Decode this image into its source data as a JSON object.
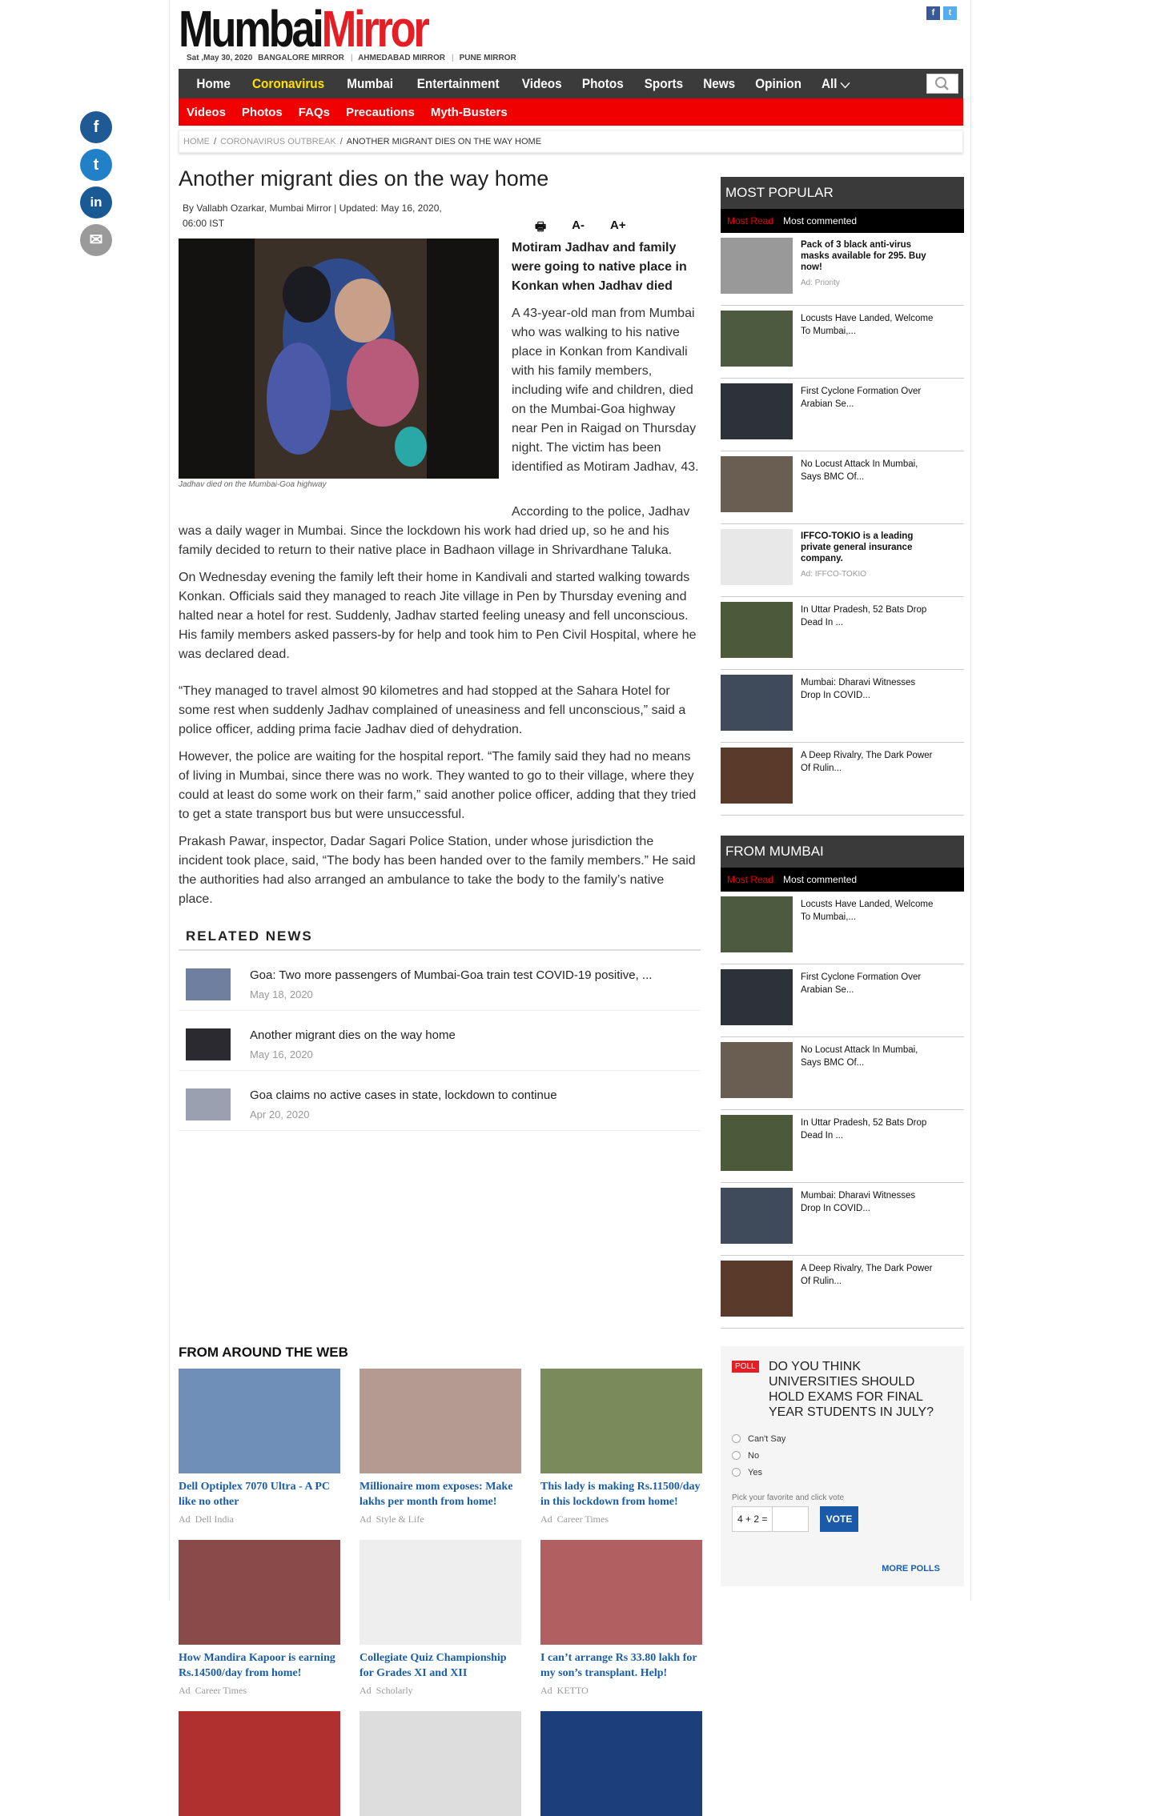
{
  "header": {
    "logo_part1": "Mumbai",
    "logo_part2": "Mirror",
    "date": "Sat ,May 30, 2020",
    "editions": [
      "BANGALORE MIRROR",
      "AHMEDABAD MIRROR",
      "PUNE MIRROR"
    ],
    "social_top": [
      "f",
      "t"
    ]
  },
  "nav_primary": [
    {
      "label": "Home",
      "active": false
    },
    {
      "label": "Coronavirus",
      "active": true
    },
    {
      "label": "Mumbai",
      "active": false
    },
    {
      "label": "Entertainment",
      "active": false
    },
    {
      "label": "Videos",
      "active": false
    },
    {
      "label": "Photos",
      "active": false
    },
    {
      "label": "Sports",
      "active": false
    },
    {
      "label": "News",
      "active": false
    },
    {
      "label": "Opinion",
      "active": false
    },
    {
      "label": "All",
      "active": false
    }
  ],
  "nav_secondary": [
    "Videos",
    "Photos",
    "FAQs",
    "Precautions",
    "Myth-Busters"
  ],
  "breadcrumb": [
    "HOME",
    "CORONAVIRUS OUTBREAK",
    "ANOTHER MIGRANT DIES ON THE WAY HOME"
  ],
  "share": {
    "facebook": "f",
    "twitter": "t",
    "linkedin": "in",
    "email": "✉"
  },
  "article": {
    "title": "Another migrant dies on the way home",
    "byline": "By Vallabh Ozarkar, Mumbai Mirror | Updated: May 16, 2020, 06:00 IST",
    "tools": {
      "print": "🖶",
      "font_down": "A-",
      "font_up": "A+"
    },
    "image_caption": "Jadhav died on the Mumbai-Goa highway",
    "lead": "Motiram Jadhav and family were going to native place in Konkan when Jadhav died",
    "p1": "A 43-year-old man from Mumbai who was walking to his native place in Konkan from Kandivali with his family members, including wife and children, died on the Mumbai-Goa highway near Pen in Raigad on Thursday night. The victim has been identified as Motiram Jadhav, 43.",
    "p2": "According to the police, Jadhav was a daily wager in Mumbai. Since the lockdown his work had dried up, so he and his family decided to return to their native place in Badhaon village in Shrivardhane Taluka.",
    "p3": "On Wednesday evening the family left their home in Kandivali and started walking towards Konkan. Officials said they managed to reach Jite village in Pen by Thursday evening and halted near a hotel for rest. Suddenly, Jadhav started feeling uneasy and fell unconscious. His family members asked passers-by for help and took him to Pen Civil Hospital, where he was declared dead.",
    "p4": "“They managed to travel almost 90 kilometres and had stopped at the Sahara Hotel for some rest when suddenly Jadhav complained of uneasiness and fell unconscious,” said a police officer, adding prima facie Jadhav died of dehydration.",
    "p5": "However, the police are waiting for the hospital report. “The family said they had no means of living in Mumbai, since there was no work. They wanted to go to their village, where they could at least do some work on their farm,” said another police officer, adding that they tried to get a state transport bus but were unsuccessful.",
    "p6": "Prakash Pawar, inspector, Dadar Sagari Police Station, under whose jurisdiction the incident took place, said, “The body has been handed over to the family members.” He said the authorities had also arranged an ambulance to take the body to the family’s native place."
  },
  "related": {
    "title": "RELATED NEWS",
    "items": [
      {
        "title": "Goa: Two more passengers of Mumbai-Goa train test COVID-19 positive, ...",
        "date": "May 18, 2020"
      },
      {
        "title": "Another migrant dies on the way home",
        "date": "May 16, 2020"
      },
      {
        "title": "Goa claims no active cases in state, lockdown to continue",
        "date": "Apr 20, 2020"
      }
    ]
  },
  "around_web": {
    "title": "FROM AROUND THE WEB",
    "cards": [
      {
        "title": "Dell Optiplex 7070 Ultra - A PC like no other",
        "ad": "Ad",
        "source": "Dell India",
        "color": "#6f8fb8"
      },
      {
        "title": "Millionaire mom exposes: Make lakhs per month from home!",
        "ad": "Ad",
        "source": "Style & Life",
        "color": "#b59a92"
      },
      {
        "title": "This lady is making Rs.11500/day in this lockdown from home!",
        "ad": "Ad",
        "source": "Career Times",
        "color": "#7a8a5a"
      },
      {
        "title": "How Mandira Kapoor is earning Rs.14500/day from home!",
        "ad": "Ad",
        "source": "Career Times",
        "color": "#8a4a4a"
      },
      {
        "title": "Collegiate Quiz Championship for Grades XI and XII",
        "ad": "Ad",
        "source": "Scholarly",
        "color": "#eeeeee"
      },
      {
        "title": "I can’t arrange Rs 33.80 lakh for my son’s transplant. Help!",
        "ad": "Ad",
        "source": "KETTO",
        "color": "#b06060"
      }
    ],
    "row3_colors": [
      "#b03030",
      "#dddddd",
      "#1b3f7a"
    ]
  },
  "sidebar": {
    "most_popular": {
      "title": "MOST POPULAR",
      "tab_active": "Most Read",
      "tab_other": "Most commented",
      "items": [
        {
          "text": "Pack of 3 black anti-virus masks available for 295. Buy now!",
          "is_ad": true,
          "ad_label": "Ad: Priority",
          "color": "#999"
        },
        {
          "text": "Locusts Have Landed, Welcome To Mumbai,...",
          "is_ad": false,
          "color": "#4d5a3f"
        },
        {
          "text": "First Cyclone Formation Over Arabian Se...",
          "is_ad": false,
          "color": "#2d3138"
        },
        {
          "text": "No Locust Attack In Mumbai, Says BMC Of...",
          "is_ad": false,
          "color": "#6a5e52"
        },
        {
          "text": "IFFCO-TOKIO is a leading private general insurance company.",
          "is_ad": true,
          "ad_label": "Ad: IFFCO-TOKIO",
          "color": "#e8e8e8"
        },
        {
          "text": "In Uttar Pradesh, 52 Bats Drop Dead In ...",
          "is_ad": false,
          "color": "#4c5a3a"
        },
        {
          "text": "Mumbai: Dharavi Witnesses Drop In COVID...",
          "is_ad": false,
          "color": "#3f4a5a"
        },
        {
          "text": "A Deep Rivalry, The Dark Power Of Rulin...",
          "is_ad": false,
          "color": "#5a3a2a"
        }
      ]
    },
    "from_mumbai": {
      "title": "FROM MUMBAI",
      "tab_active": "Most Read",
      "tab_other": "Most commented",
      "items": [
        {
          "text": "Locusts Have Landed, Welcome To Mumbai,...",
          "color": "#4d5a3f"
        },
        {
          "text": "First Cyclone Formation Over Arabian Se...",
          "color": "#2d3138"
        },
        {
          "text": "No Locust Attack In Mumbai, Says BMC Of...",
          "color": "#6a5e52"
        },
        {
          "text": "In Uttar Pradesh, 52 Bats Drop Dead In ...",
          "color": "#4c5a3a"
        },
        {
          "text": "Mumbai: Dharavi Witnesses Drop In COVID...",
          "color": "#3f4a5a"
        },
        {
          "text": "A Deep Rivalry, The Dark Power Of Rulin...",
          "color": "#5a3a2a"
        }
      ]
    },
    "poll": {
      "tag": "POLL",
      "question": "DO YOU THINK UNIVERSITIES SHOULD HOLD EXAMS FOR FINAL YEAR STUDENTS IN JULY?",
      "options": [
        "Can't Say",
        "No",
        "Yes"
      ],
      "hint": "Pick your favorite and click vote",
      "captcha": "4 + 2 =",
      "vote": "VOTE",
      "more": "MORE POLLS"
    }
  },
  "colors": {
    "brand_red": "#e31e24",
    "nav_dark": "#3b3b3b",
    "nav_red": "#f00000",
    "active_yellow": "#ffe000",
    "link_blue": "#1a5da8"
  }
}
